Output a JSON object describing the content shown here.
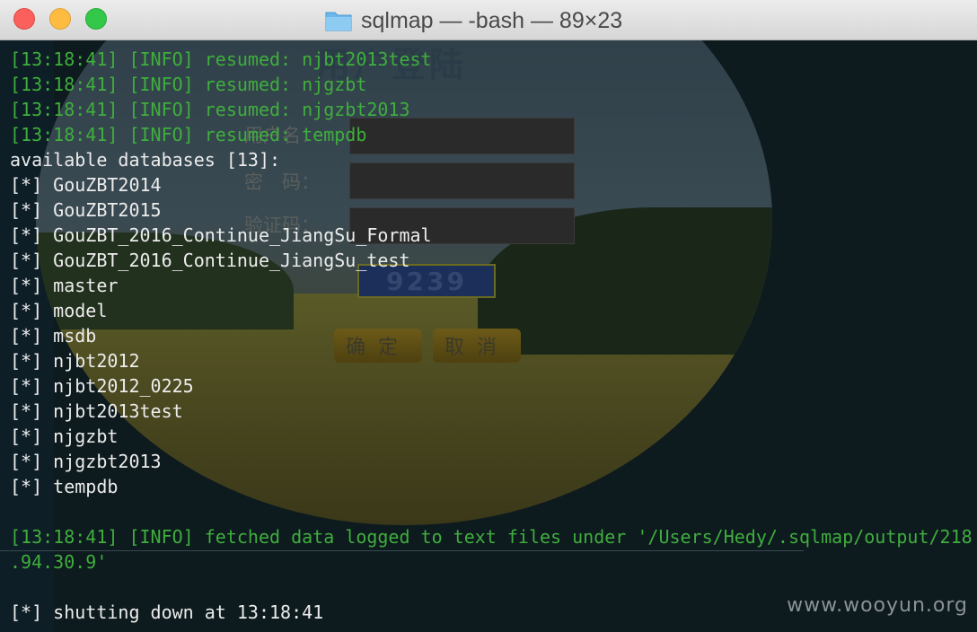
{
  "window": {
    "title": "sqlmap — -bash — 89×23"
  },
  "background_page": {
    "heading": "用户登陆",
    "username_label": "用户名：",
    "password_label": "密　码：",
    "captcha_label": "验证码：",
    "captcha_value": "9239",
    "confirm_button": "确定",
    "cancel_button": "取消"
  },
  "terminal": {
    "lines": [
      {
        "text": "[13:18:41] [INFO] resumed: njbt2013test",
        "color": "green"
      },
      {
        "text": "[13:18:41] [INFO] resumed: njgzbt",
        "color": "green"
      },
      {
        "text": "[13:18:41] [INFO] resumed: njgzbt2013",
        "color": "green"
      },
      {
        "text": "[13:18:41] [INFO] resumed: tempdb",
        "color": "green"
      },
      {
        "text": "available databases [13]:",
        "color": "white"
      },
      {
        "text": "[*] GouZBT2014",
        "color": "white"
      },
      {
        "text": "[*] GouZBT2015",
        "color": "white"
      },
      {
        "text": "[*] GouZBT_2016_Continue_JiangSu_Formal",
        "color": "white"
      },
      {
        "text": "[*] GouZBT_2016_Continue_JiangSu_test",
        "color": "white"
      },
      {
        "text": "[*] master",
        "color": "white"
      },
      {
        "text": "[*] model",
        "color": "white"
      },
      {
        "text": "[*] msdb",
        "color": "white"
      },
      {
        "text": "[*] njbt2012",
        "color": "white"
      },
      {
        "text": "[*] njbt2012_0225",
        "color": "white"
      },
      {
        "text": "[*] njbt2013test",
        "color": "white"
      },
      {
        "text": "[*] njgzbt",
        "color": "white"
      },
      {
        "text": "[*] njgzbt2013",
        "color": "white"
      },
      {
        "text": "[*] tempdb",
        "color": "white"
      },
      {
        "text": "",
        "color": "white"
      },
      {
        "text": "[13:18:41] [INFO] fetched data logged to text files under '/Users/Hedy/.sqlmap/output/218",
        "color": "green"
      },
      {
        "text": ".94.30.9'",
        "color": "green"
      },
      {
        "text": "",
        "color": "white"
      },
      {
        "text": "[*] shutting down at 13:18:41",
        "color": "white"
      }
    ]
  },
  "watermark": "www.wooyun.org",
  "colors": {
    "info_green": "#3fae3d",
    "text_white": "#ececec",
    "terminal_bg": "#0d1a1e"
  },
  "icons": {
    "title_icon": "folder-icon"
  }
}
